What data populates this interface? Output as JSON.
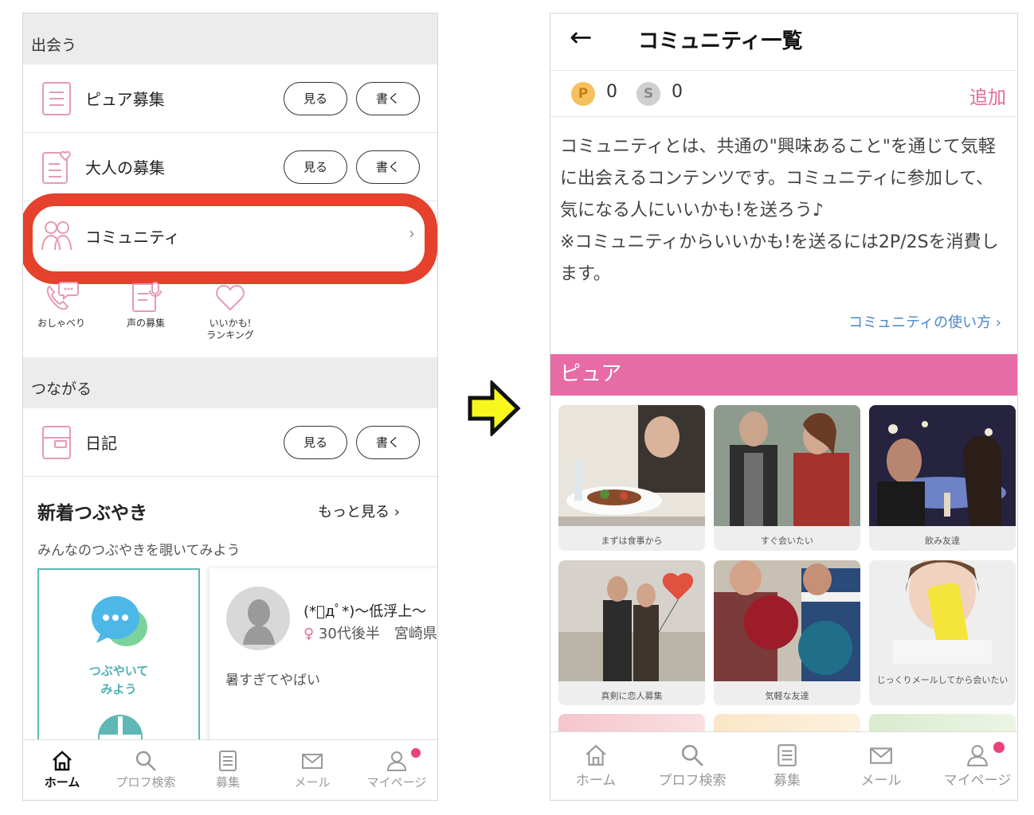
{
  "left": {
    "section_meet": "出会う",
    "pure_boshu": {
      "label": "ピュア募集",
      "see": "見る",
      "write": "書く"
    },
    "otona_boshu": {
      "label": "大人の募集",
      "see": "見る",
      "write": "書く"
    },
    "community": {
      "label": "コミュニティ",
      "chevron": "›"
    },
    "quick_links": [
      {
        "label": "おしゃべり"
      },
      {
        "label": "声の募集"
      },
      {
        "label_line1": "いいかも!",
        "label_line2": "ランキング"
      }
    ],
    "section_connect": "つながる",
    "diary": {
      "label": "日記",
      "see": "見る",
      "write": "書く"
    },
    "tsubuyaki": {
      "title": "新着つぶやき",
      "more": "もっと見る ›",
      "subtitle": "みんなのつぶやきを覗いてみよう",
      "post_card_line1": "つぶやいて",
      "post_card_line2": "みよう",
      "feed": {
        "name": "(*ﾟдﾟ*)〜低浮上〜",
        "gender_symbol": "♀",
        "meta": "30代後半　宮崎県",
        "body": "暑すぎてやばい"
      }
    },
    "tabbar": [
      {
        "label": "ホーム",
        "icon": "home-icon",
        "active": true
      },
      {
        "label": "プロフ検索",
        "icon": "search-icon"
      },
      {
        "label": "募集",
        "icon": "list-icon"
      },
      {
        "label": "メール",
        "icon": "mail-icon"
      },
      {
        "label": "マイページ",
        "icon": "person-icon"
      }
    ]
  },
  "right": {
    "back": "←",
    "title": "コミュニティ一覧",
    "points": {
      "p_label": "P",
      "p_value": "0",
      "s_label": "S",
      "s_value": "0"
    },
    "add": "追加",
    "description_1": "コミュニティとは、共通の\"興味あること\"を通じて気軽に出会えるコンテンツです。コミュニティに参加して、気になる人にいいかも!を送ろう♪",
    "description_2": "※コミュニティからいいかも!を送るには2P/2Sを消費します。",
    "how_to": "コミュニティの使い方 ›",
    "category": "ピュア",
    "tiles": [
      {
        "caption": "まずは食事から"
      },
      {
        "caption": "すぐ会いたい"
      },
      {
        "caption": "飲み友達"
      },
      {
        "caption": "真剣に恋人募集"
      },
      {
        "caption": "気軽な友達"
      },
      {
        "caption": "じっくりメールしてから会いたい"
      }
    ],
    "tabbar": [
      {
        "label": "ホーム",
        "icon": "home-icon"
      },
      {
        "label": "プロフ検索",
        "icon": "search-icon"
      },
      {
        "label": "募集",
        "icon": "list-icon"
      },
      {
        "label": "メール",
        "icon": "mail-icon"
      },
      {
        "label": "マイページ",
        "icon": "person-icon"
      }
    ]
  },
  "colors": {
    "highlight": "#e5412c",
    "pink": "#e76ba4",
    "teal": "#5fb8b6",
    "arrow": "#f7f71e"
  }
}
